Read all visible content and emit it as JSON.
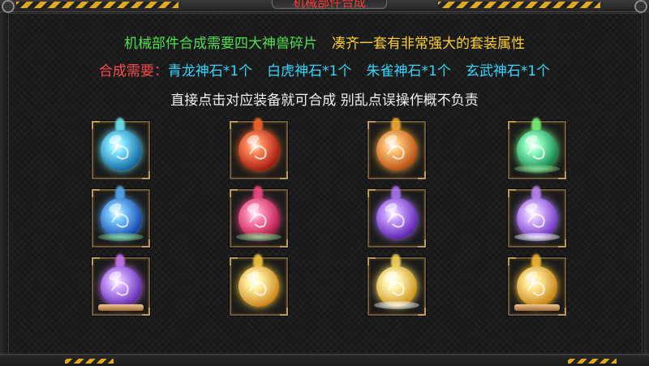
{
  "window": {
    "title": "机械部件合成"
  },
  "info": {
    "line1_green": "机械部件合成需要四大神兽碎片",
    "line1_yellow": "凑齐一套有非常强大的套装属性",
    "line2_label": "合成需要：",
    "requirements": [
      "青龙神石*1个",
      "白虎神石*1个",
      "朱雀神石*1个",
      "玄武神石*1个"
    ],
    "line3": "直接点击对应装备就可合成  别乱点误操作概不负责"
  },
  "colors": {
    "green": "#4ee04e",
    "yellow": "#ffd02a",
    "red": "#ff4a4a",
    "cyan": "#2fd8ff",
    "slot_border": "#6e5a32"
  },
  "items": [
    {
      "name": "cyan-orb",
      "core": "#7fe6ff",
      "edge": "#0a5e9a",
      "flame": "#6ff0ff",
      "base": "none"
    },
    {
      "name": "red-orb",
      "core": "#ff8a5a",
      "edge": "#a0100c",
      "flame": "#ff6a2a",
      "base": "none"
    },
    {
      "name": "orange-orb",
      "core": "#ffc070",
      "edge": "#b0460c",
      "flame": "#ffb030",
      "base": "none"
    },
    {
      "name": "green-orb",
      "core": "#8effc0",
      "edge": "#0a7a45",
      "flame": "#7cff80",
      "base": "leaf"
    },
    {
      "name": "blue-orb",
      "core": "#79c8ff",
      "edge": "#0c3ea8",
      "flame": "#5ab0ff",
      "base": "leaf"
    },
    {
      "name": "pink-orb",
      "core": "#ff8ab8",
      "edge": "#b0103e",
      "flame": "#ff4a8a",
      "base": "leaf"
    },
    {
      "name": "purple-orb",
      "core": "#c8a0ff",
      "edge": "#5a1ab0",
      "flame": "#b07aff",
      "base": "none"
    },
    {
      "name": "violet-orb",
      "core": "#d8b8ff",
      "edge": "#6a2ac0",
      "flame": "#c08aff",
      "base": "cloud"
    },
    {
      "name": "purple-pedestal-orb",
      "core": "#d0a8ff",
      "edge": "#5a20b0",
      "flame": "#d07aff",
      "base": "pedestal"
    },
    {
      "name": "gold-orb",
      "core": "#fff0a0",
      "edge": "#c87a0a",
      "flame": "#ffd040",
      "base": "none"
    },
    {
      "name": "gold-cloud-orb",
      "core": "#fff3b0",
      "edge": "#c88a0a",
      "flame": "#ffe060",
      "base": "cloud"
    },
    {
      "name": "gold-pedestal-orb",
      "core": "#ffe690",
      "edge": "#c07a0a",
      "flame": "#ffc030",
      "base": "pedestal"
    }
  ]
}
